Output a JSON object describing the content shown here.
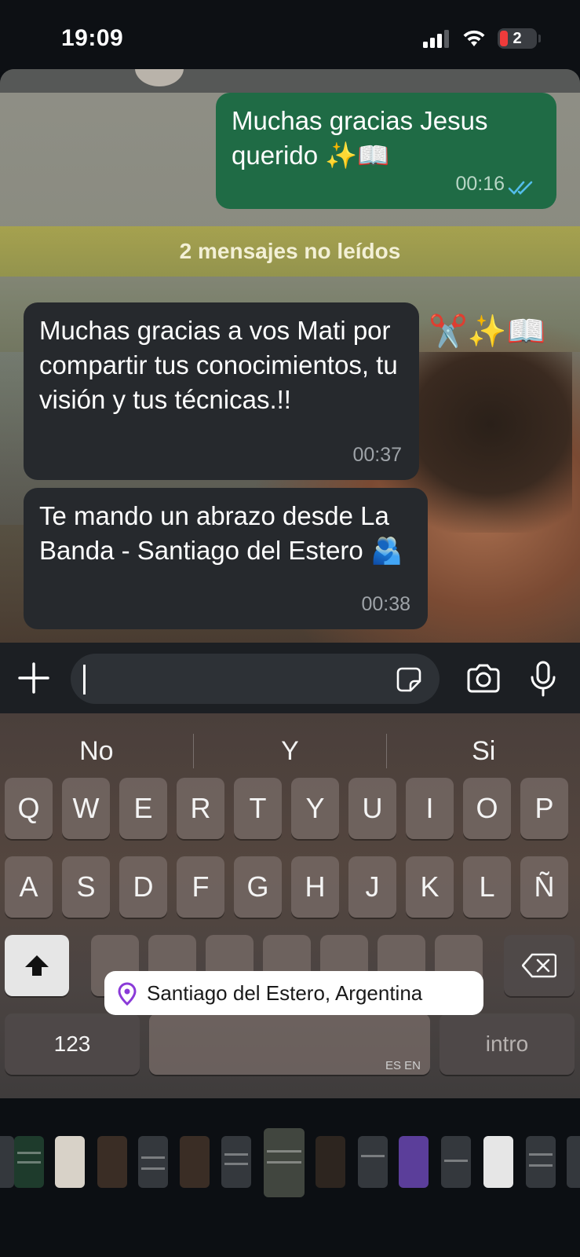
{
  "status_bar": {
    "time": "19:09",
    "battery_level": "2"
  },
  "chat": {
    "outgoing": {
      "text": "Muchas gracias Jesus querido ✨📖",
      "time": "00:16"
    },
    "unread_banner": "2 mensajes no leídos",
    "incoming": [
      {
        "text": "Muchas gracias a vos Mati por compartir tus conocimientos, tu visión y tus técnicas.!!",
        "time": "00:37"
      },
      {
        "text": "Te mando un abrazo desde La Banda - Santiago del Estero 🫂",
        "time": "00:38"
      }
    ],
    "reaction": "✂️✨📖"
  },
  "input_bar": {
    "icons": [
      "plus-icon",
      "sticker-icon",
      "camera-icon",
      "microphone-icon"
    ],
    "value": ""
  },
  "keyboard": {
    "suggestions": [
      "No",
      "Y",
      "Si"
    ],
    "row1": [
      "Q",
      "W",
      "E",
      "R",
      "T",
      "Y",
      "U",
      "I",
      "O",
      "P"
    ],
    "row2": [
      "A",
      "S",
      "D",
      "F",
      "G",
      "H",
      "J",
      "K",
      "L",
      "Ñ"
    ],
    "numbers_key": "123",
    "language_label": "ES EN",
    "return_key": "intro",
    "location_suggestion": "Santiago del Estero, Argentina"
  },
  "colors": {
    "outgoing_bubble": "#1f6b45",
    "incoming_bubble": "#26292d",
    "read_ticks": "#53bdeb"
  }
}
